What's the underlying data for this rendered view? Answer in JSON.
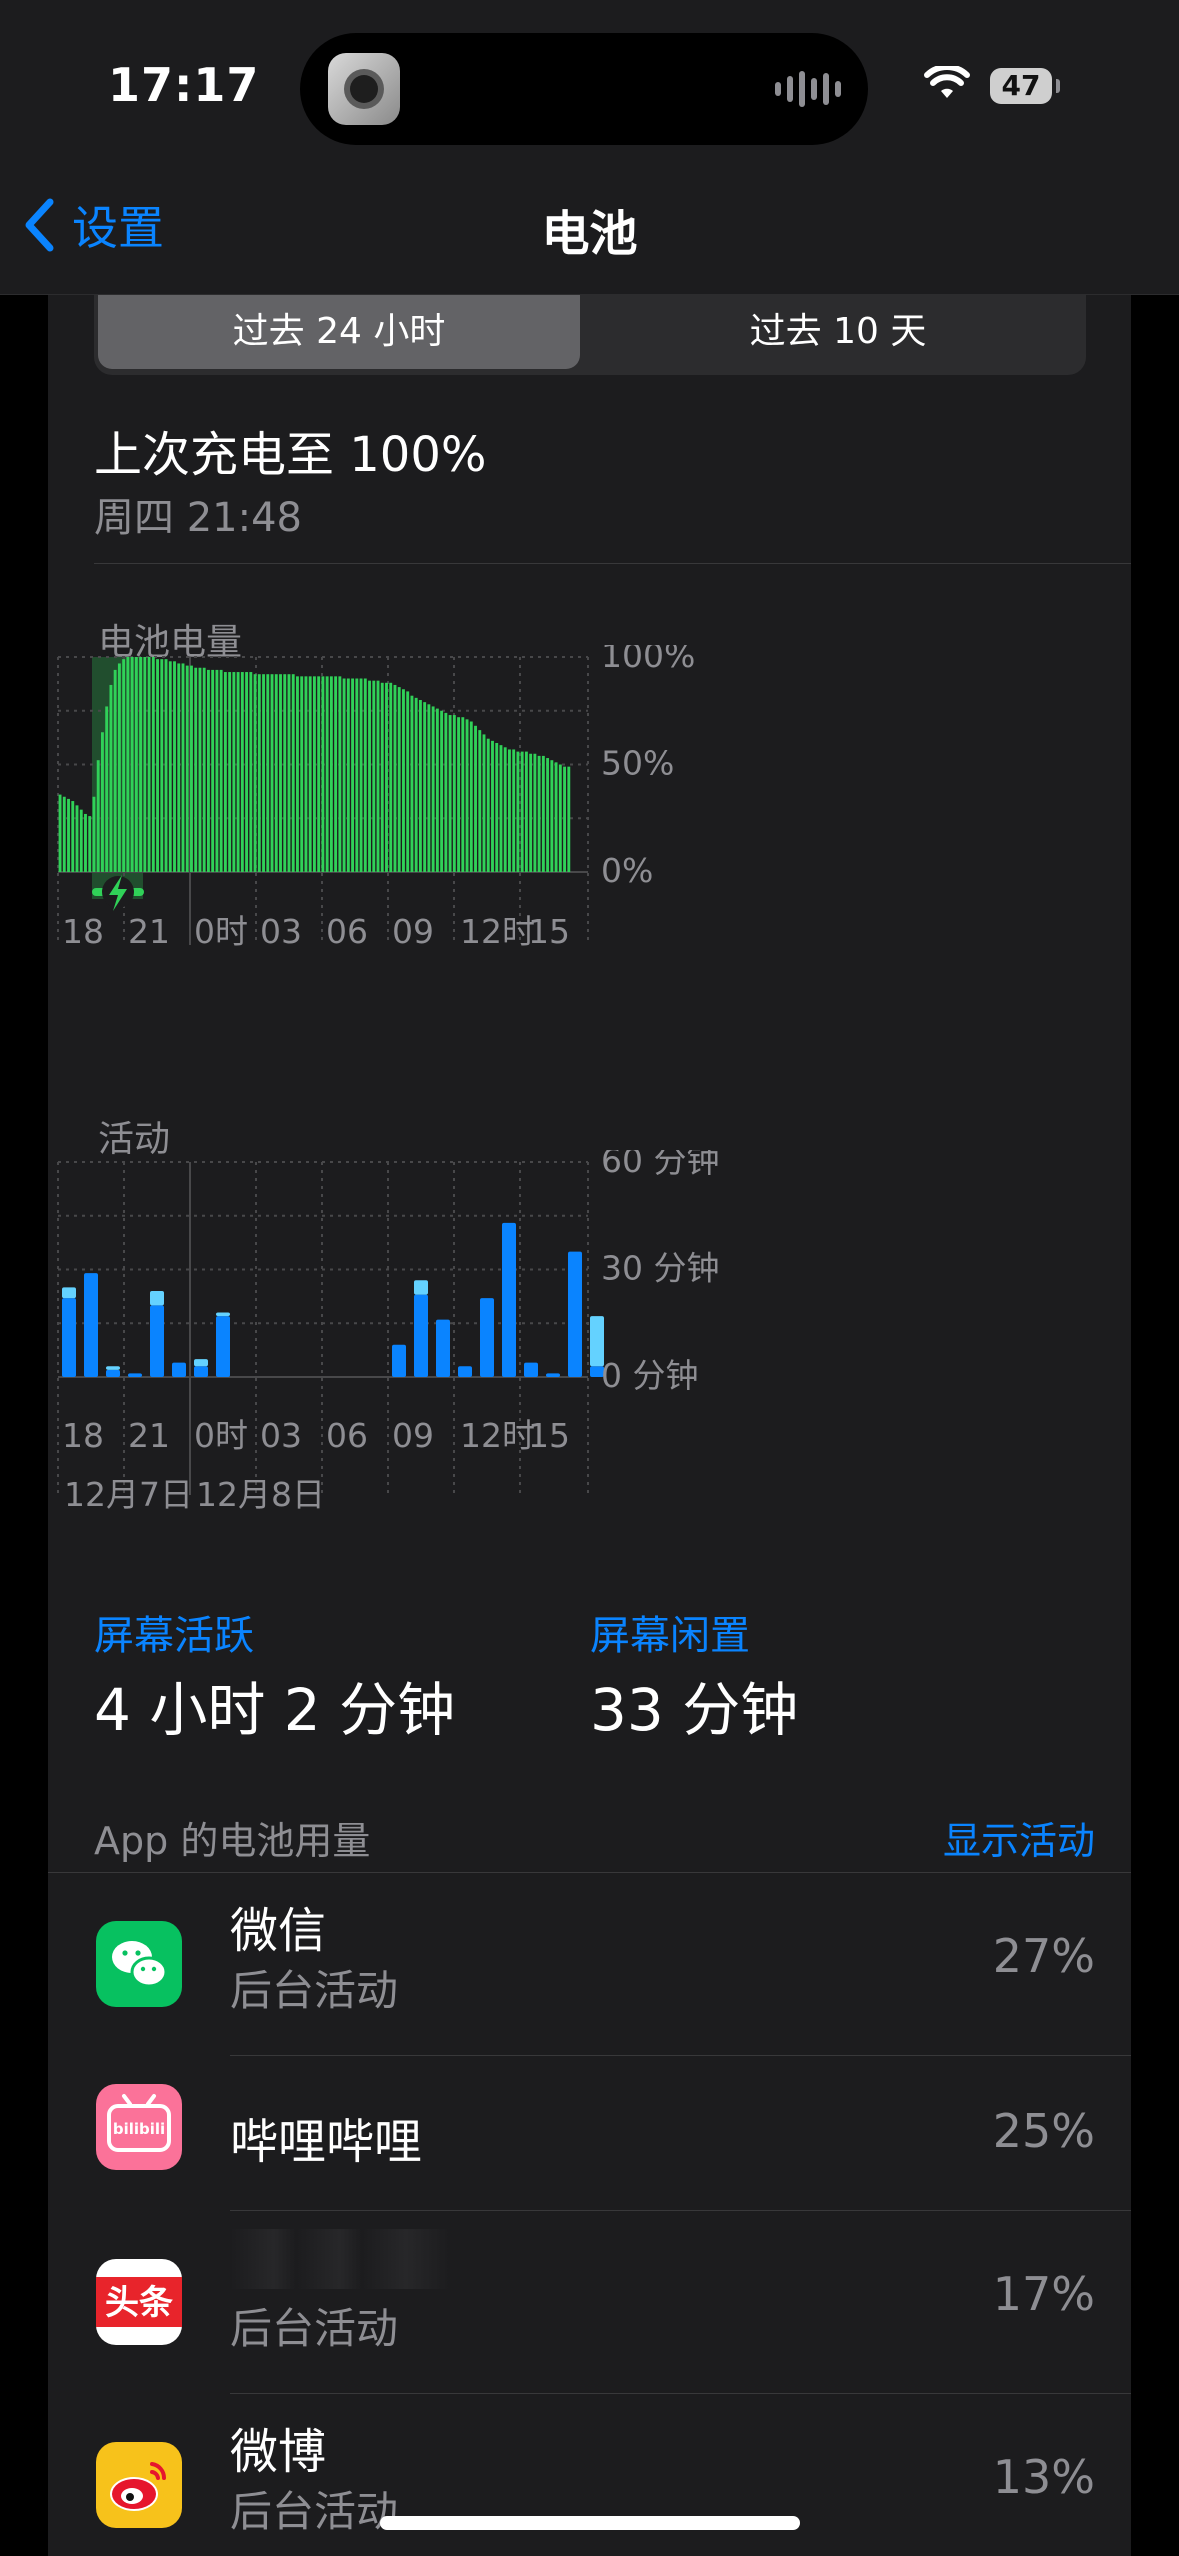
{
  "status_bar": {
    "time": "17:17",
    "battery": "47"
  },
  "nav": {
    "back_label": "设置",
    "title": "电池"
  },
  "segments": {
    "active": "过去 24 小时",
    "inactive": "过去 10 天"
  },
  "last_charge": {
    "title": "上次充电至 100%",
    "time": "周四 21:48"
  },
  "battery_chart": {
    "label": "电池电量",
    "y_ticks": [
      "100%",
      "50%",
      "0%"
    ],
    "x_ticks": [
      "18",
      "21",
      "0时",
      "03",
      "06",
      "09",
      "12时",
      "15"
    ]
  },
  "activity_chart": {
    "label": "活动",
    "y_ticks": [
      "60 分钟",
      "30 分钟",
      "0 分钟"
    ],
    "x_ticks": [
      "18",
      "21",
      "0时",
      "03",
      "06",
      "09",
      "12时",
      "15"
    ],
    "date_labels": [
      "12月7日",
      "12月8日"
    ]
  },
  "chart_data": [
    {
      "type": "bar",
      "title": "电池电量",
      "ylim": [
        0,
        100
      ],
      "unit": "%",
      "values": [
        36,
        35,
        34,
        33,
        31,
        29,
        27,
        26,
        35,
        52,
        65,
        77,
        87,
        94,
        97,
        99,
        100,
        100,
        100,
        100,
        100,
        100,
        100,
        99,
        99,
        99,
        98,
        98,
        97,
        97,
        96,
        96,
        95,
        95,
        95,
        94,
        94,
        94,
        94,
        93,
        93,
        93,
        93,
        93,
        93,
        93,
        92,
        92,
        92,
        92,
        92,
        92,
        92,
        92,
        92,
        92,
        91,
        91,
        91,
        91,
        91,
        91,
        91,
        91,
        91,
        91,
        91,
        90,
        90,
        90,
        90,
        90,
        90,
        89,
        89,
        89,
        88,
        88,
        88,
        87,
        86,
        85,
        84,
        82,
        81,
        80,
        79,
        78,
        77,
        76,
        75,
        74,
        73,
        73,
        72,
        72,
        71,
        70,
        68,
        66,
        64,
        62,
        61,
        60,
        59,
        58,
        57,
        57,
        56,
        56,
        56,
        55,
        55,
        54,
        54,
        53,
        52,
        51,
        50,
        49,
        49
      ]
    },
    {
      "type": "bar",
      "title": "活动",
      "ylim": [
        0,
        60
      ],
      "unit": "分钟",
      "series": [
        {
          "name": "屏幕活跃",
          "values": [
            22,
            29,
            2,
            1,
            20,
            4,
            3,
            17,
            0,
            0,
            0,
            0,
            0,
            0,
            0,
            9,
            23,
            16,
            3,
            22,
            43,
            4,
            1,
            35,
            3
          ]
        },
        {
          "name": "屏幕闲置",
          "values": [
            3,
            0,
            1,
            0,
            4,
            0,
            2,
            1,
            0,
            0,
            0,
            0,
            0,
            0,
            0,
            0,
            4,
            0,
            0,
            0,
            0,
            0,
            0,
            0,
            14
          ]
        }
      ]
    }
  ],
  "stats": {
    "active_label": "屏幕活跃",
    "active_value": "4 小时 2 分钟",
    "idle_label": "屏幕闲置",
    "idle_value": "33 分钟"
  },
  "app_usage": {
    "header": "App 的电池用量",
    "show_activity": "显示活动",
    "apps": [
      {
        "name": "微信",
        "sub": "后台活动",
        "pct": "27%"
      },
      {
        "name": "哔哩哔哩",
        "sub": "",
        "pct": "25%"
      },
      {
        "name": "",
        "sub": "后台活动",
        "pct": "17%"
      },
      {
        "name": "微博",
        "sub": "后台活动",
        "pct": "13%"
      }
    ]
  },
  "colors": {
    "green": "#30d158",
    "blue": "#0a84ff",
    "light_blue": "#64d2ff",
    "accent": "#0a84ff"
  }
}
